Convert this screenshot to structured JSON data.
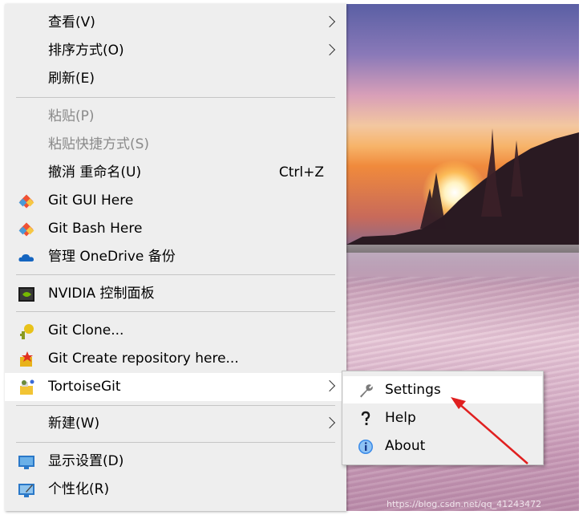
{
  "context_menu": {
    "items": {
      "view": {
        "label": "查看(V)"
      },
      "sort_by": {
        "label": "排序方式(O)"
      },
      "refresh": {
        "label": "刷新(E)"
      },
      "paste": {
        "label": "粘贴(P)"
      },
      "paste_shortcut": {
        "label": "粘贴快捷方式(S)"
      },
      "undo_rename": {
        "label": "撤消 重命名(U)",
        "shortcut": "Ctrl+Z"
      },
      "git_gui": {
        "label": "Git GUI Here",
        "icon": "git-gui-icon"
      },
      "git_bash": {
        "label": "Git Bash Here",
        "icon": "git-bash-icon"
      },
      "onedrive": {
        "label": "管理 OneDrive 备份",
        "icon": "onedrive-cloud-icon"
      },
      "nvidia": {
        "label": "NVIDIA 控制面板",
        "icon": "nvidia-icon"
      },
      "git_clone": {
        "label": "Git Clone...",
        "icon": "git-clone-icon"
      },
      "git_create": {
        "label": "Git Create repository here...",
        "icon": "git-create-repo-icon"
      },
      "tortoisegit": {
        "label": "TortoiseGit",
        "icon": "tortoisegit-icon"
      },
      "new": {
        "label": "新建(W)"
      },
      "display_settings": {
        "label": "显示设置(D)",
        "icon": "display-settings-icon"
      },
      "personalize": {
        "label": "个性化(R)",
        "icon": "personalize-icon"
      }
    }
  },
  "submenu": {
    "settings": {
      "label": "Settings",
      "icon": "wrench-icon"
    },
    "help": {
      "label": "Help",
      "icon": "help-icon"
    },
    "about": {
      "label": "About",
      "icon": "info-icon"
    }
  },
  "watermark": "https://blog.csdn.net/qq_41243472",
  "colors": {
    "menu_bg": "#eeeeee",
    "highlight": "#ffffff",
    "disabled_text": "#8a8a8a",
    "annotation_arrow": "#e02020"
  }
}
